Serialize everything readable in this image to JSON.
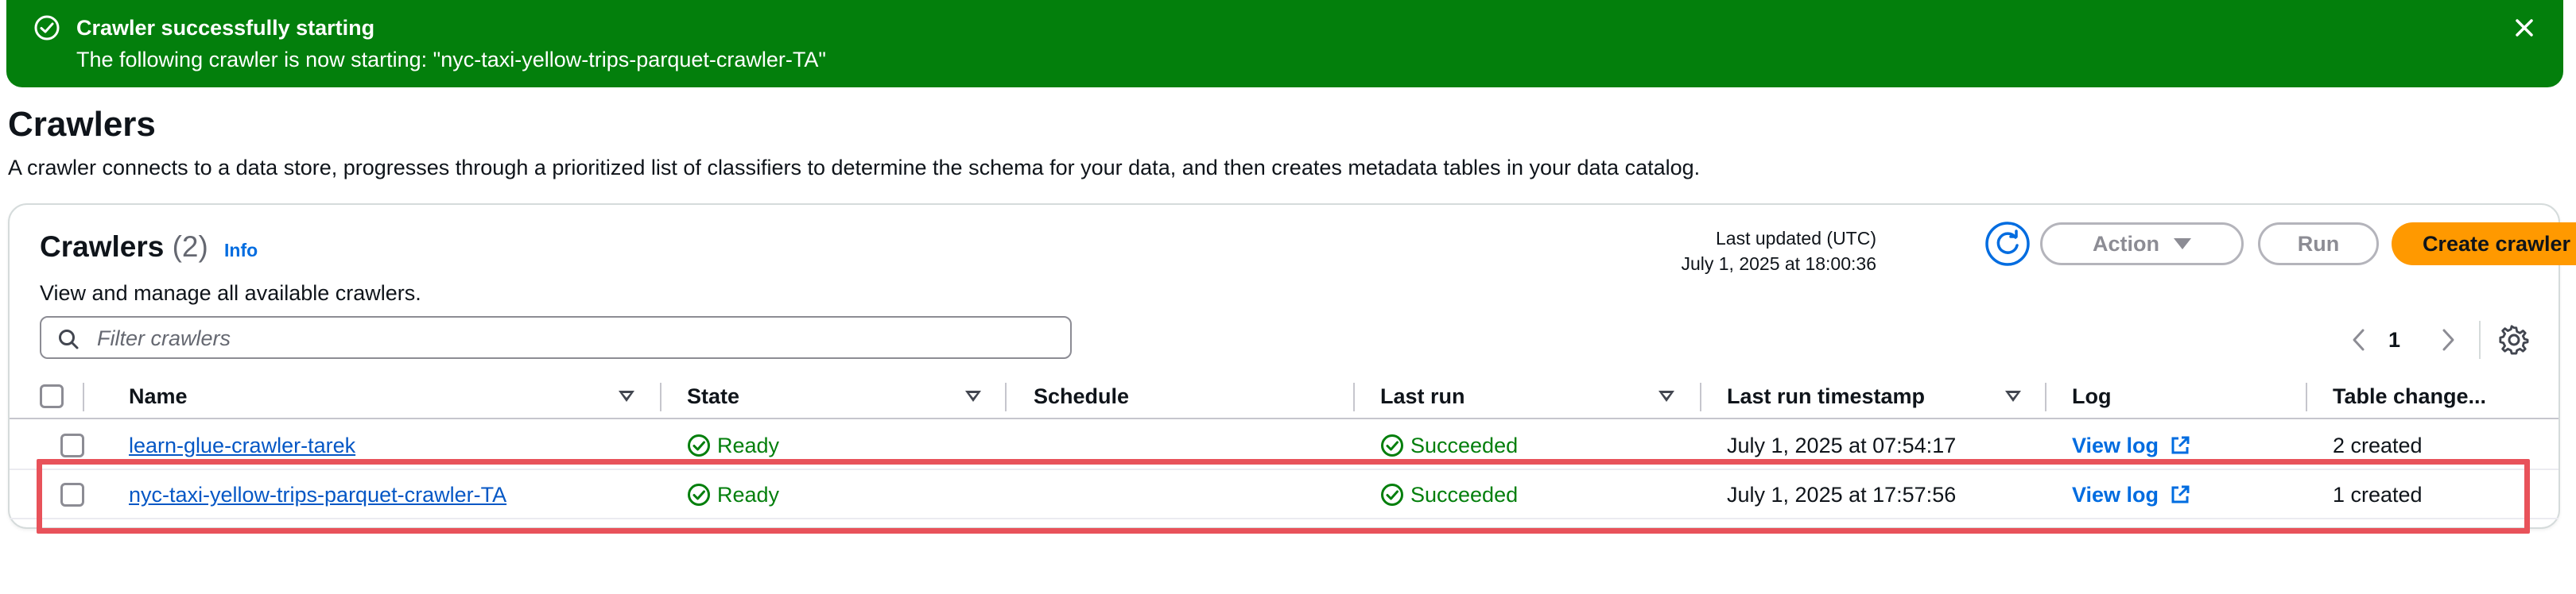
{
  "flash": {
    "title": "Crawler successfully starting",
    "message": "The following crawler is now starting: \"nyc-taxi-yellow-trips-parquet-crawler-TA\""
  },
  "header": {
    "title": "Crawlers",
    "description": "A crawler connects to a data store, progresses through a prioritized list of classifiers to determine the schema for your data, and then creates metadata tables in your data catalog."
  },
  "container": {
    "title": "Crawlers",
    "count": "(2)",
    "info": "Info",
    "description": "View and manage all available crawlers.",
    "last_updated_label": "Last updated (UTC)",
    "last_updated_value": "July 1, 2025 at 18:00:36",
    "action_label": "Action",
    "run_label": "Run",
    "create_label": "Create crawler",
    "filter_placeholder": "Filter crawlers",
    "page_number": "1"
  },
  "table": {
    "columns": {
      "name": "Name",
      "state": "State",
      "schedule": "Schedule",
      "last_run": "Last run",
      "last_run_timestamp": "Last run timestamp",
      "log": "Log",
      "table_changes": "Table change..."
    },
    "rows": [
      {
        "name": "learn-glue-crawler-tarek",
        "state": "Ready",
        "schedule": "",
        "last_run": "Succeeded",
        "timestamp": "July 1, 2025 at 07:54:17",
        "log": "View log",
        "changes": "2 created"
      },
      {
        "name": "nyc-taxi-yellow-trips-parquet-crawler-TA",
        "state": "Ready",
        "schedule": "",
        "last_run": "Succeeded",
        "timestamp": "July 1, 2025 at 17:57:56",
        "log": "View log",
        "changes": "1 created"
      }
    ]
  },
  "colors": {
    "success": "#037f0c",
    "primary": "#ff9900",
    "link": "#0557c5",
    "highlight": "#e8525a"
  },
  "icons": {
    "flash": "status-positive-icon",
    "close": "close-icon",
    "refresh": "refresh-icon",
    "search": "search-icon",
    "settings": "gear-icon",
    "external": "external-link-icon"
  }
}
